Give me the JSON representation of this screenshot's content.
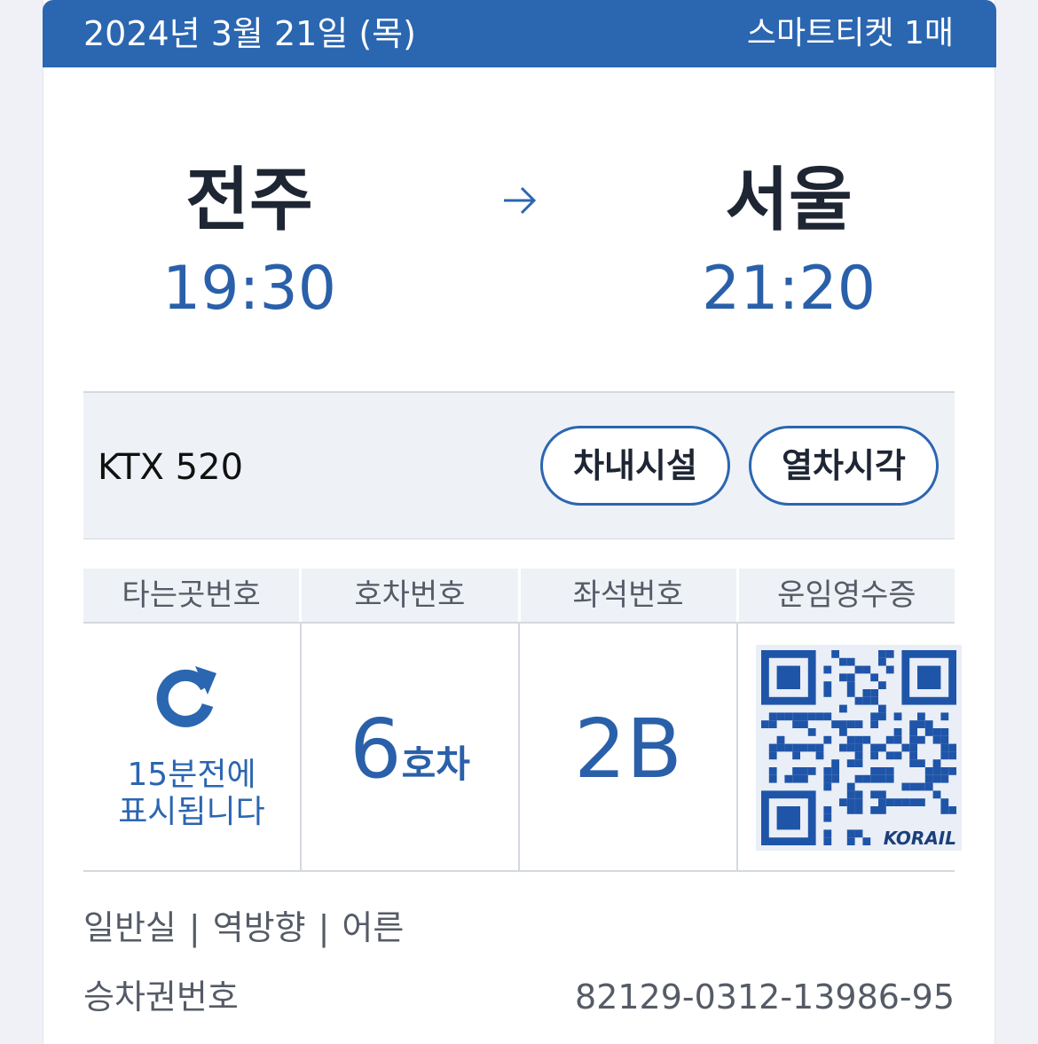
{
  "header": {
    "date": "2024년 3월 21일 (목)",
    "ticket_count": "스마트티켓 1매"
  },
  "route": {
    "departure_station": "전주",
    "departure_time": "19:30",
    "arrival_station": "서울",
    "arrival_time": "21:20"
  },
  "train": {
    "name": "KTX 520",
    "facilities_button": "차내시설",
    "timetable_button": "열차시각"
  },
  "details": {
    "headers": [
      "타는곳번호",
      "호차번호",
      "좌석번호",
      "운임영수증"
    ],
    "gate_note_line1": "15분전에",
    "gate_note_line2": "표시됩니다",
    "car_number": "6",
    "car_unit": "호차",
    "seat": "2B",
    "receipt_logo": "KORAIL"
  },
  "info": {
    "class": "일반실",
    "direction": "역방향",
    "passenger": "어른",
    "separator": "|",
    "ticket_number_label": "승차권번호",
    "ticket_number": "82129-0312-13986-95"
  },
  "colors": {
    "accent": "#2b66b1",
    "text_dark": "#1e2533",
    "text_gray": "#555b66"
  },
  "icons": {
    "arrow": "arrow-right-icon",
    "gate": "refresh-icon",
    "receipt": "qr-code-icon"
  }
}
